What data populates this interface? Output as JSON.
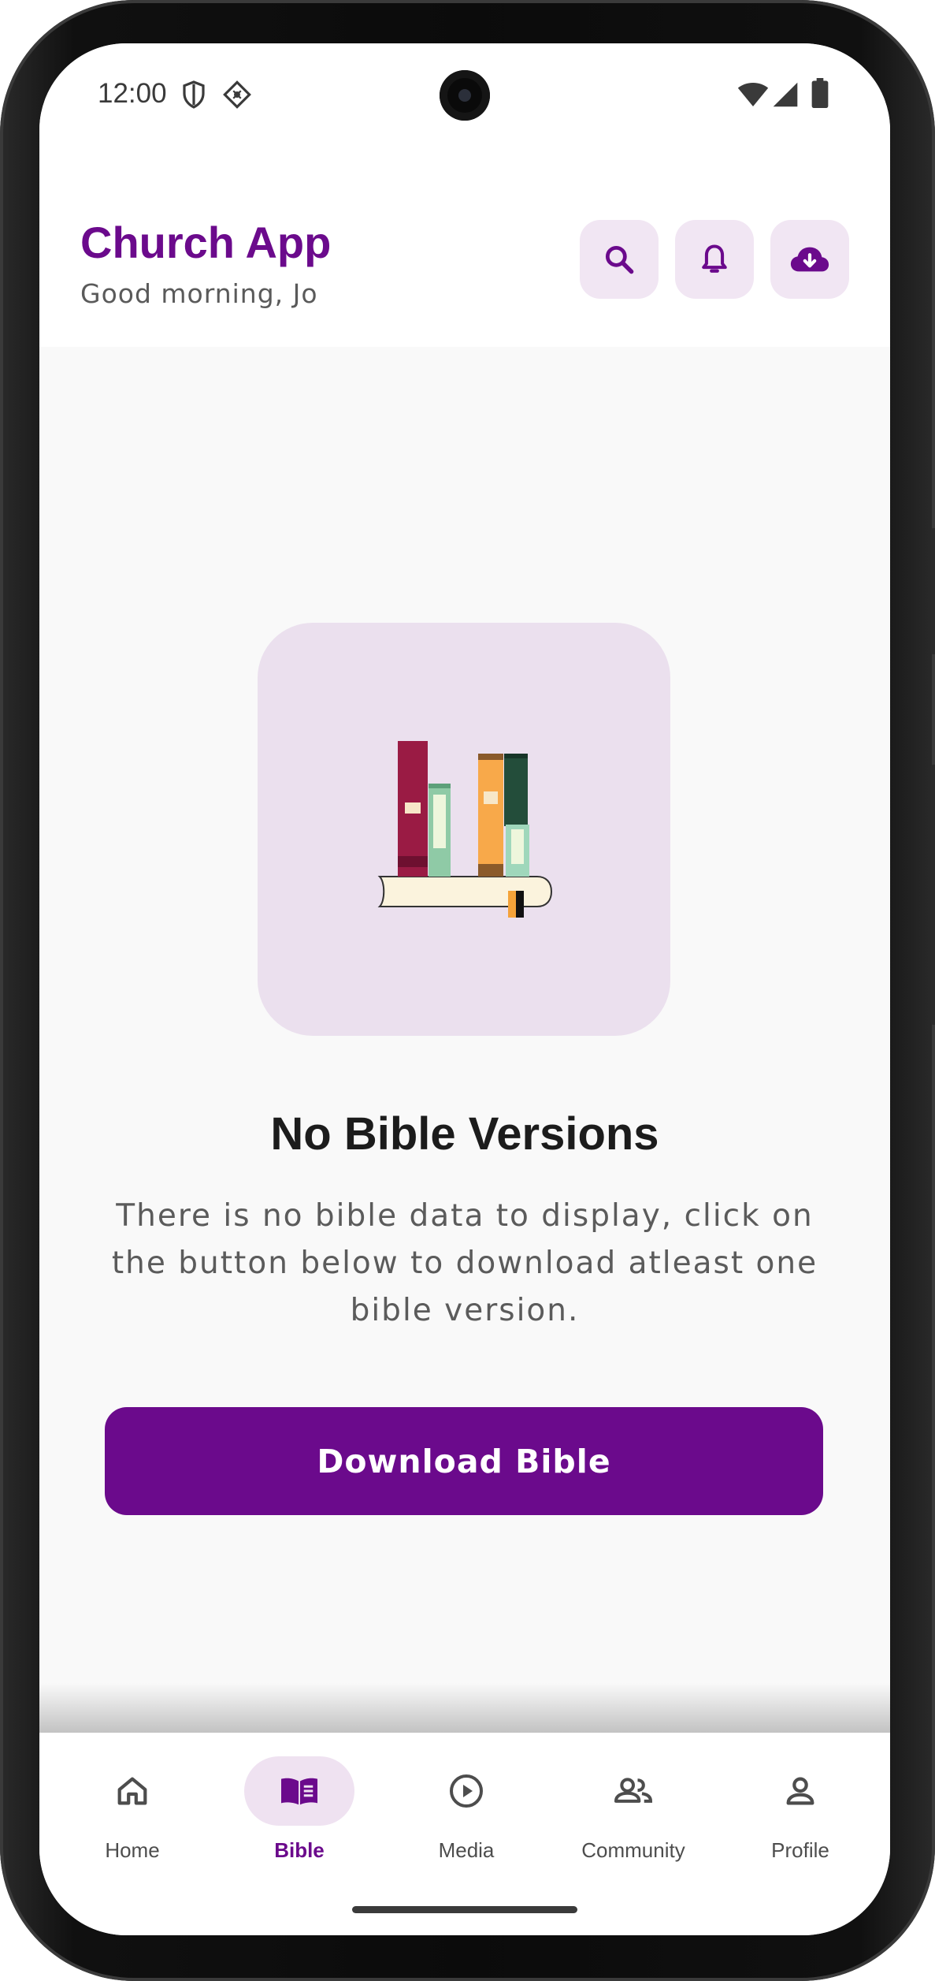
{
  "status_bar": {
    "time": "12:00",
    "left_icons": [
      "shield-icon",
      "vpn-key-icon"
    ],
    "right_icons": [
      "wifi-icon",
      "signal-icon",
      "battery-icon"
    ]
  },
  "header": {
    "title": "Church App",
    "greeting": "Good morning, Jo",
    "actions": [
      {
        "icon": "search-icon"
      },
      {
        "icon": "bell-icon"
      },
      {
        "icon": "cloud-download-icon"
      }
    ]
  },
  "empty_state": {
    "illustration": "books-on-shelf-illustration",
    "title": "No Bible Versions",
    "description": "There is no bible data to display, click on the button below to download atleast one bible version.",
    "button_label": "Download Bible"
  },
  "bottom_nav": {
    "active": "Bible",
    "items": [
      {
        "label": "Home",
        "icon": "home-icon"
      },
      {
        "label": "Bible",
        "icon": "book-icon"
      },
      {
        "label": "Media",
        "icon": "play-circle-icon"
      },
      {
        "label": "Community",
        "icon": "people-icon"
      },
      {
        "label": "Profile",
        "icon": "person-icon"
      }
    ]
  },
  "colors": {
    "brand": "#6b0a8c",
    "icon_button_bg": "#f1e6f3",
    "illustration_bg": "#ebe0ee",
    "screen_bg": "#f9f9f9"
  }
}
